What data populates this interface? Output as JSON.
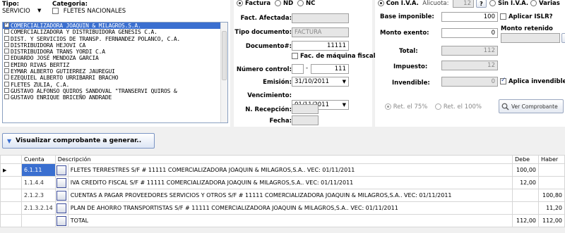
{
  "tipo": {
    "label": "Tipo:",
    "value": "SERVICIO"
  },
  "categoria": {
    "label": "Categoria:",
    "value": "FLETES NACIONALES",
    "checked": true
  },
  "companies": [
    {
      "name": "COMERCIALIZADORA JOAQUIN & MILAGROS.S.A.",
      "checked": true,
      "selected": true
    },
    {
      "name": "COMERCIALIZADORA Y DISTRIBUIDORA GENESIS C.A.",
      "checked": false
    },
    {
      "name": "DIST. Y SERVICIOS DE TRANSP. FERNANDEZ POLANCO, C.A.",
      "checked": false
    },
    {
      "name": "DISTRIBUIDORA HEJOVI CA",
      "checked": false
    },
    {
      "name": "DISTRIBUIDORA TRANS YORDI C.A",
      "checked": false
    },
    {
      "name": "EDUARDO JOSÉ MENDOZA GARCIA",
      "checked": false
    },
    {
      "name": "EMIRO RIVAS BERTIZ",
      "checked": false
    },
    {
      "name": "EYMAR ALBERTO GUTIERREZ JAUREGUI",
      "checked": false
    },
    {
      "name": "EZEQUIEL ALBERTO URRIBARRI BRACHO",
      "checked": false
    },
    {
      "name": "FLETES ZULIA, C.A.",
      "checked": false
    },
    {
      "name": "GUSTAVO ALFONSO QUIROS SANDOVAL \"TRANSERVI QUIROS &",
      "checked": false
    },
    {
      "name": "GUSTAVO ENRIQUE BRICEÑO ANDRADE",
      "checked": false
    }
  ],
  "doc_type_radios": {
    "factura": "Factura",
    "nd": "ND",
    "nc": "NC"
  },
  "fact_afectada": {
    "label": "Fact. Afectada:",
    "value": ""
  },
  "tipo_documento": {
    "label": "Tipo documento:",
    "value": "FACTURA"
  },
  "documento": {
    "label": "Documento#:",
    "value": "11111"
  },
  "fac_maquina": {
    "label": "Fac. de máquina fiscal"
  },
  "numero_control": {
    "label": "Número control:",
    "prefix": "",
    "sep": "-",
    "value": "111"
  },
  "emision": {
    "label": "Emisión:",
    "value": "31/10/2011"
  },
  "vencimiento": {
    "label": "Vencimiento:",
    "value": "01/11/2011"
  },
  "n_recepcion": {
    "label": "N. Recepción:",
    "value": ""
  },
  "fecha": {
    "label": "Fecha:",
    "value": ""
  },
  "iva": {
    "con_label": "Con I.V.A.",
    "alicuota_label": "Alicuota:",
    "alicuota": "12",
    "help": "?",
    "sin_label": "Sin I.V.A.",
    "varias_label": "Varias"
  },
  "base_imponible": {
    "label": "Base imponible:",
    "value": "100"
  },
  "aplicar_islr": {
    "label": "Aplicar ISLR?"
  },
  "monto_retenido": {
    "label": "Monto retenido",
    "value": ""
  },
  "monto_exento": {
    "label": "Monto exento:",
    "value": "0"
  },
  "total": {
    "label": "Total:",
    "value": "112"
  },
  "impuesto": {
    "label": "Impuesto:",
    "value": "12"
  },
  "invendible": {
    "label": "Invendible:",
    "value": "0",
    "aplica_label": "Aplica invendible"
  },
  "retencion": {
    "r75": "Ret. el 75%",
    "r100": "Ret. el 100%"
  },
  "ver_comprobante": "Ver Comprobante",
  "visualizar": "Visualizar comprobante a generar..",
  "grid": {
    "headers": {
      "cuenta": "Cuenta",
      "descripcion": "Descripción",
      "debe": "Debe",
      "haber": "Haber"
    },
    "rows": [
      {
        "cuenta": "6.1.11",
        "descripcion": "FLETES TERRESTRES S/F # 11111 COMERCIALIZADORA JOAQUIN & MILAGROS,S.A.. VEC: 01/11/2011",
        "debe": "100,00",
        "haber": ""
      },
      {
        "cuenta": "1.1.4.4",
        "descripcion": "IVA CREDITO FISCAL S/F # 11111 COMERCIALIZADORA JOAQUIN & MILAGROS,S.A.. VEC: 01/11/2011",
        "debe": "12,00",
        "haber": ""
      },
      {
        "cuenta": "2.1.2.3",
        "descripcion": "CUENTAS A PAGAR PROVEEDORES SERVICIOS Y OTROS S/F # 11111 COMERCIALIZADORA JOAQUIN & MILAGROS,S.A.. VEC: 01/11/2011",
        "debe": "",
        "haber": "100,80"
      },
      {
        "cuenta": "2.1.3.2.14",
        "descripcion": "PLAN DE AHORRO TRANSPORTISTAS S/F # 11111 COMERCIALIZADORA JOAQUIN & MILAGROS,S.A.. VEC: 01/11/2011",
        "debe": "",
        "haber": "11,20"
      },
      {
        "cuenta": "",
        "descripcion": "TOTAL",
        "debe": "112,00",
        "haber": "112,00"
      }
    ]
  }
}
